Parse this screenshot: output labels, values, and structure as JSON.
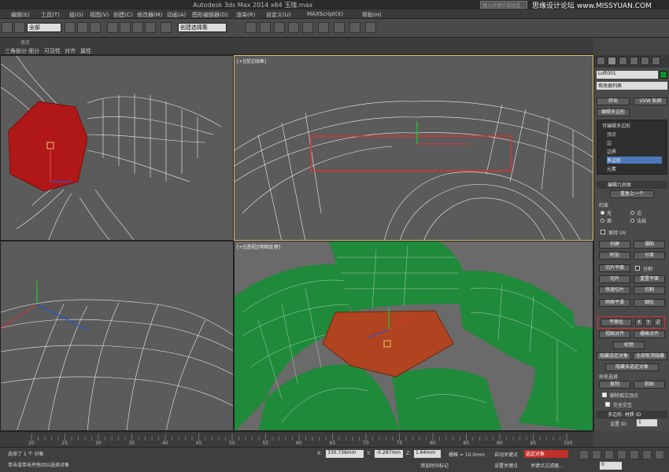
{
  "window": {
    "title": "Autodesk 3ds Max  2014 x64    玉瑰.max",
    "search_placeholder": "键入关键字或短语",
    "watermark": "思缘设计论坛  www.MISSYUAN.COM"
  },
  "menu": {
    "items": [
      "编辑(E)",
      "工具(T)",
      "组(G)",
      "视图(V)",
      "创建(C)",
      "修改器(M)",
      "动画(A)",
      "图形编辑器(D)",
      "渲染(R)",
      "自定义(U)",
      "MAXScript(X)",
      "帮助(H)"
    ]
  },
  "toolbar": {
    "filter_select": "全部",
    "view_select": "视图",
    "selection_set": "创建选择集"
  },
  "ribbon": {
    "label": "填充",
    "subtools": [
      "三角剖分",
      "细分",
      "可见性",
      "对齐",
      "属性"
    ]
  },
  "viewports": {
    "top_right_label": "[+][前][线框]",
    "bottom_right_label": "[+][透视][明暗处理]"
  },
  "command_panel": {
    "object_name": "Loft001",
    "modifier_list": "修改器列表",
    "extrude_btn": "挤出",
    "uvw_btn": "UVW 贴图",
    "edit_poly_btn": "编辑多边形",
    "stack": {
      "root": "可编辑多边形",
      "items": [
        "顶点",
        "边",
        "边界",
        "多边形",
        "元素"
      ],
      "selected_index": 3
    },
    "edit_geometry": {
      "title": "编辑几何体",
      "repeat_last": "重复上一个",
      "constraints_label": "约束",
      "constraints": [
        "无",
        "边",
        "面",
        "法线"
      ],
      "preserve_uv": "保持 UV",
      "create": "创建",
      "collapse": "塌陷",
      "attach": "附加",
      "detach": "分离",
      "slice_plane": "切片平面",
      "split": "分割",
      "slice": "切片",
      "reset_plane": "重置平面",
      "quick_slice": "快速切片",
      "cut": "切割",
      "msmooth": "网格平滑",
      "tessellate": "细化",
      "make_planar": "平面化",
      "axis_x": "X",
      "axis_y": "Y",
      "axis_z": "Z",
      "view_align": "视图对齐",
      "grid_align": "栅格对齐",
      "relax": "松弛",
      "hide_selected": "隐藏选定对象",
      "unhide_all": "全部取消隐藏",
      "hide_unselected": "隐藏未选定对象",
      "named_selections": "命名选择",
      "copy": "复制",
      "paste": "粘贴",
      "delete_isolated": "删除孤立顶点",
      "full_interactivity": "完全交互"
    },
    "material_ids": {
      "title": "多边形: 材质 ID",
      "set_id_label": "设置 ID:",
      "set_id_value": "1",
      "select_id_label": "选择 ID",
      "select_id_value": "1"
    }
  },
  "timeline": {
    "ticks": [
      "20",
      "25",
      "30",
      "35",
      "40",
      "45",
      "50",
      "55",
      "60",
      "65",
      "70",
      "75",
      "80",
      "85",
      "90",
      "95",
      "100"
    ]
  },
  "status": {
    "selected": "选择了 1 个 对象",
    "hint": "单击或单击并拖动以选择对象",
    "x_label": "X:",
    "x_value": "330.736mm",
    "y_label": "Y:",
    "y_value": "-0.287mm",
    "z_label": "Z:",
    "z_value": "1.64mm",
    "grid": "栅格 = 10.0mm",
    "add_time_tag": "添加时间标记",
    "auto_key": "自动关键点",
    "set_key": "设置关键点",
    "selected_object": "选定对象",
    "key_filters": "关键点过滤器...",
    "frame": "0"
  },
  "colors": {
    "highlight_red": "#e03030",
    "mesh_green": "#1f8a3a",
    "face_red": "#b01818",
    "selected_blue": "#4b78b8"
  }
}
